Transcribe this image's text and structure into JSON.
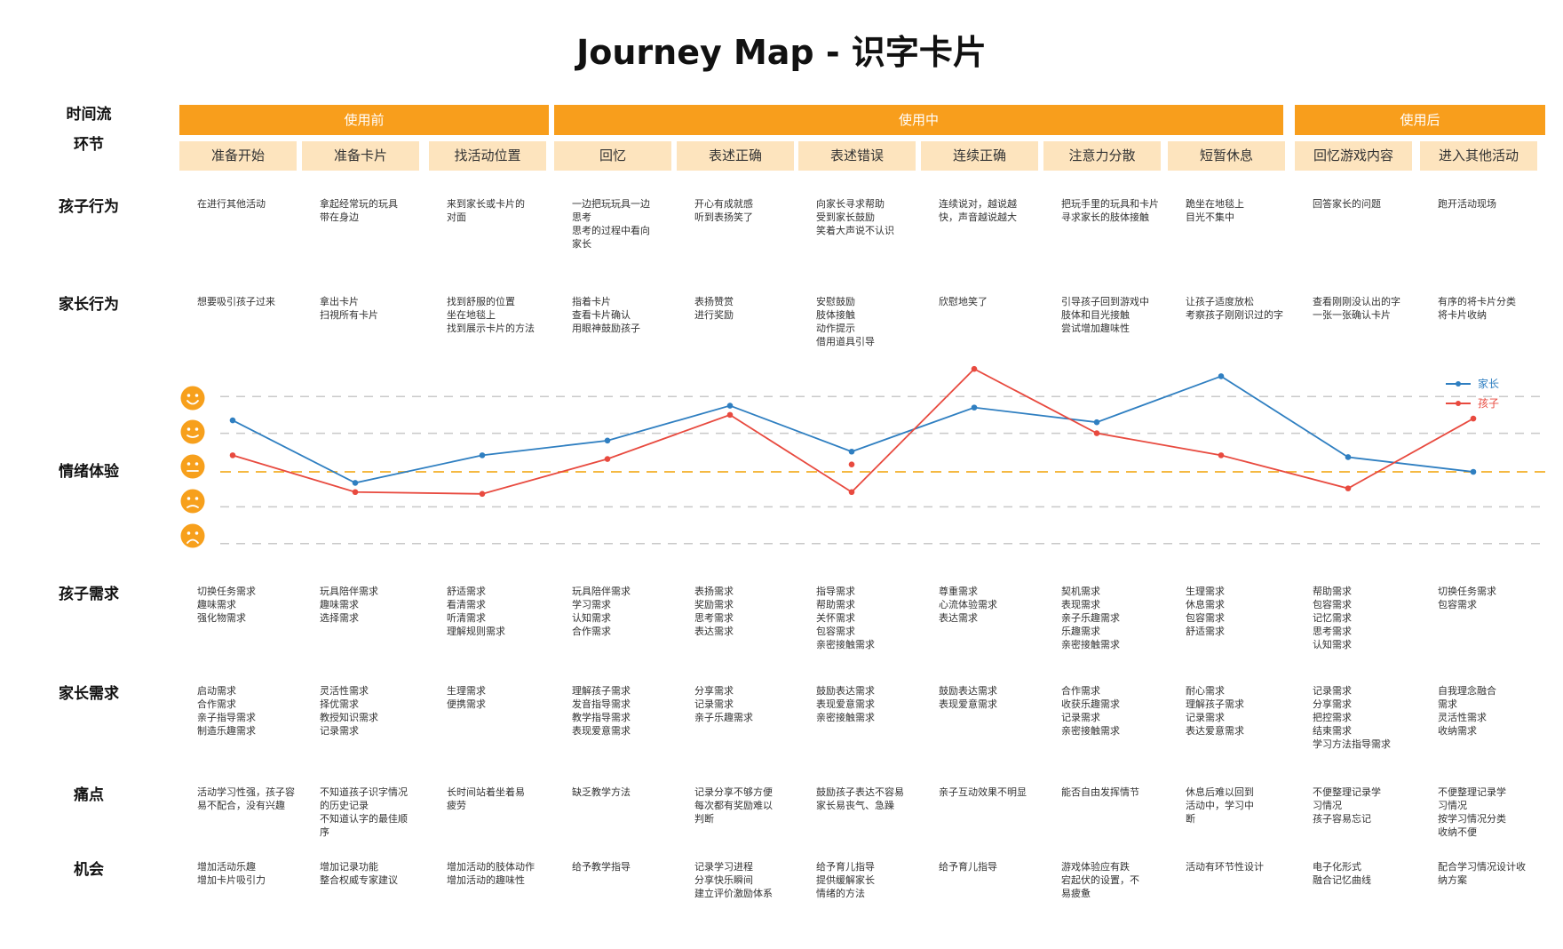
{
  "title": "Journey Map - 识字卡片",
  "row_labels": {
    "timeline": "时间流",
    "stage": "环节",
    "child_behavior": "孩子行为",
    "parent_behavior": "家长行为",
    "emotion": "情绪体验",
    "child_needs": "孩子需求",
    "parent_needs": "家长需求",
    "pain_points": "痛点",
    "opportunities": "机会"
  },
  "phases": [
    "使用前",
    "使用中",
    "使用后"
  ],
  "stages": [
    "准备开始",
    "准备卡片",
    "找活动位置",
    "回忆",
    "表述正确",
    "表述错误",
    "连续正确",
    "注意力分散",
    "短暂休息",
    "回忆游戏内容",
    "进入其他活动"
  ],
  "rows": {
    "child_behavior": [
      "在进行其他活动",
      "拿起经常玩的玩具\n带在身边",
      "来到家长或卡片的\n对面",
      "一边把玩玩具一边\n思考\n思考的过程中看向\n家长",
      "开心有成就感\n听到表扬笑了",
      "向家长寻求帮助\n受到家长鼓励\n笑着大声说不认识",
      "连续说对，越说越\n快，声音越说越大",
      "把玩手里的玩具和卡片\n寻求家长的肢体接触",
      "跪坐在地毯上\n目光不集中",
      "回答家长的问题",
      "跑开活动现场"
    ],
    "parent_behavior": [
      "想要吸引孩子过来",
      "拿出卡片\n扫視所有卡片",
      "找到舒服的位置\n坐在地毯上\n找到展示卡片的方法",
      "指着卡片\n查看卡片确认\n用眼神鼓励孩子",
      "表扬赞赏\n进行奖励",
      "安慰鼓励\n肢体接触\n动作提示\n借用道具引导",
      "欣慰地笑了",
      "引导孩子回到游戏中\n肢体和目光接触\n尝试增加趣味性",
      "让孩子适度放松\n考察孩子刚刚识过的字",
      "查看刚刚没认出的字\n一张一张确认卡片",
      "有序的将卡片分类\n将卡片收纳"
    ],
    "child_needs": [
      "切换任务需求\n趣味需求\n强化物需求",
      "玩具陪伴需求\n趣味需求\n选择需求",
      "舒适需求\n看清需求\n听清需求\n理解规则需求",
      "玩具陪伴需求\n学习需求\n认知需求\n合作需求",
      "表扬需求\n奖励需求\n思考需求\n表达需求",
      "指导需求\n帮助需求\n关怀需求\n包容需求\n亲密接触需求",
      "尊重需求\n心流体验需求\n表达需求",
      "契机需求\n表现需求\n亲子乐趣需求\n乐趣需求\n亲密接触需求",
      "生理需求\n休息需求\n包容需求\n舒适需求",
      "帮助需求\n包容需求\n记忆需求\n思考需求\n认知需求",
      "切换任务需求\n包容需求"
    ],
    "parent_needs": [
      "启动需求\n合作需求\n亲子指导需求\n制造乐趣需求",
      "灵活性需求\n择优需求\n教授知识需求\n记录需求",
      "生理需求\n便携需求",
      "理解孩子需求\n发音指导需求\n教学指导需求\n表现爱意需求",
      "分享需求\n记录需求\n亲子乐趣需求",
      "鼓励表达需求\n表现爱意需求\n亲密接触需求",
      "鼓励表达需求\n表现爱意需求",
      "合作需求\n收获乐趣需求\n记录需求\n亲密接触需求",
      "耐心需求\n理解孩子需求\n记录需求\n表达爱意需求",
      "记录需求\n分享需求\n把控需求\n结束需求\n学习方法指导需求",
      "自我理念融合\n需求\n灵活性需求\n收纳需求"
    ],
    "pain_points": [
      "活动学习性强，孩子容\n易不配合，没有兴趣",
      "不知道孩子识字情况\n的历史记录\n不知道认字的最佳顺\n序",
      "长时间站着坐着易\n疲劳",
      "缺乏教学方法",
      "记录分享不够方便\n每次都有奖励难以\n判断",
      "鼓励孩子表达不容易\n家长易丧气、急躁",
      "亲子互动效果不明显",
      "能否自由发挥情节",
      "休息后难以回到\n活动中，学习中\n断",
      "不便整理记录学\n习情况\n孩子容易忘记",
      "不便整理记录学\n习情况\n按学习情况分类\n收纳不便"
    ],
    "opportunities": [
      "增加活动乐趣\n增加卡片吸引力",
      "增加记录功能\n整合权威专家建议",
      "增加活动的肢体动作\n增加活动的趣味性",
      "给予教学指导",
      "记录学习进程\n分享快乐瞬间\n建立评价激励体系",
      "给予育儿指导\n提供缓解家长\n情绪的方法",
      "给予育儿指导",
      "游戏体验应有跌\n宕起伏的设置，不\n易疲惫",
      "活动有环节性设计",
      "电子化形式\n融合记忆曲线",
      "配合学习情况设计收\n纳方案"
    ]
  },
  "emotion_faces": [
    "very-happy",
    "happy",
    "neutral",
    "sad",
    "very-sad"
  ],
  "chart_data": {
    "type": "line",
    "categories": [
      "准备开始",
      "准备卡片",
      "找活动位置",
      "回忆",
      "表述正确",
      "表述错误",
      "连续正确",
      "注意力分散",
      "短暂休息",
      "回忆游戏内容",
      "进入其他活动"
    ],
    "ylim": [
      -2.2,
      2.2
    ],
    "baseline": 0,
    "series": [
      {
        "name": "家长",
        "color": "#2f7fc1",
        "values": [
          1.4,
          -0.3,
          0.45,
          0.85,
          1.8,
          0.55,
          1.75,
          1.35,
          2.6,
          0.4,
          0.0
        ]
      },
      {
        "name": "孩子",
        "color": "#e84a3f",
        "values": [
          0.45,
          -0.55,
          -0.6,
          0.35,
          1.55,
          -0.55,
          2.8,
          1.05,
          0.45,
          -0.45,
          1.45
        ]
      }
    ],
    "annotation_points": [
      {
        "series": "孩子",
        "category": "表述错误",
        "value": 0.2
      }
    ],
    "legend_position": "top-right"
  }
}
